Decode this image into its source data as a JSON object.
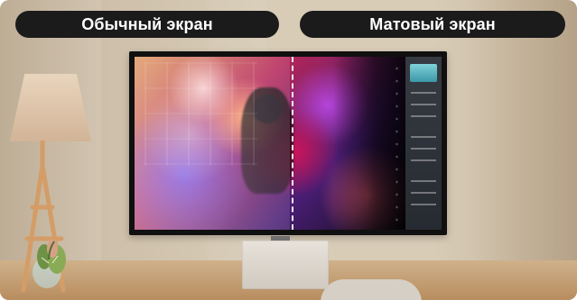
{
  "labels": {
    "left": "Обычный экран",
    "right": "Матовый экран"
  }
}
